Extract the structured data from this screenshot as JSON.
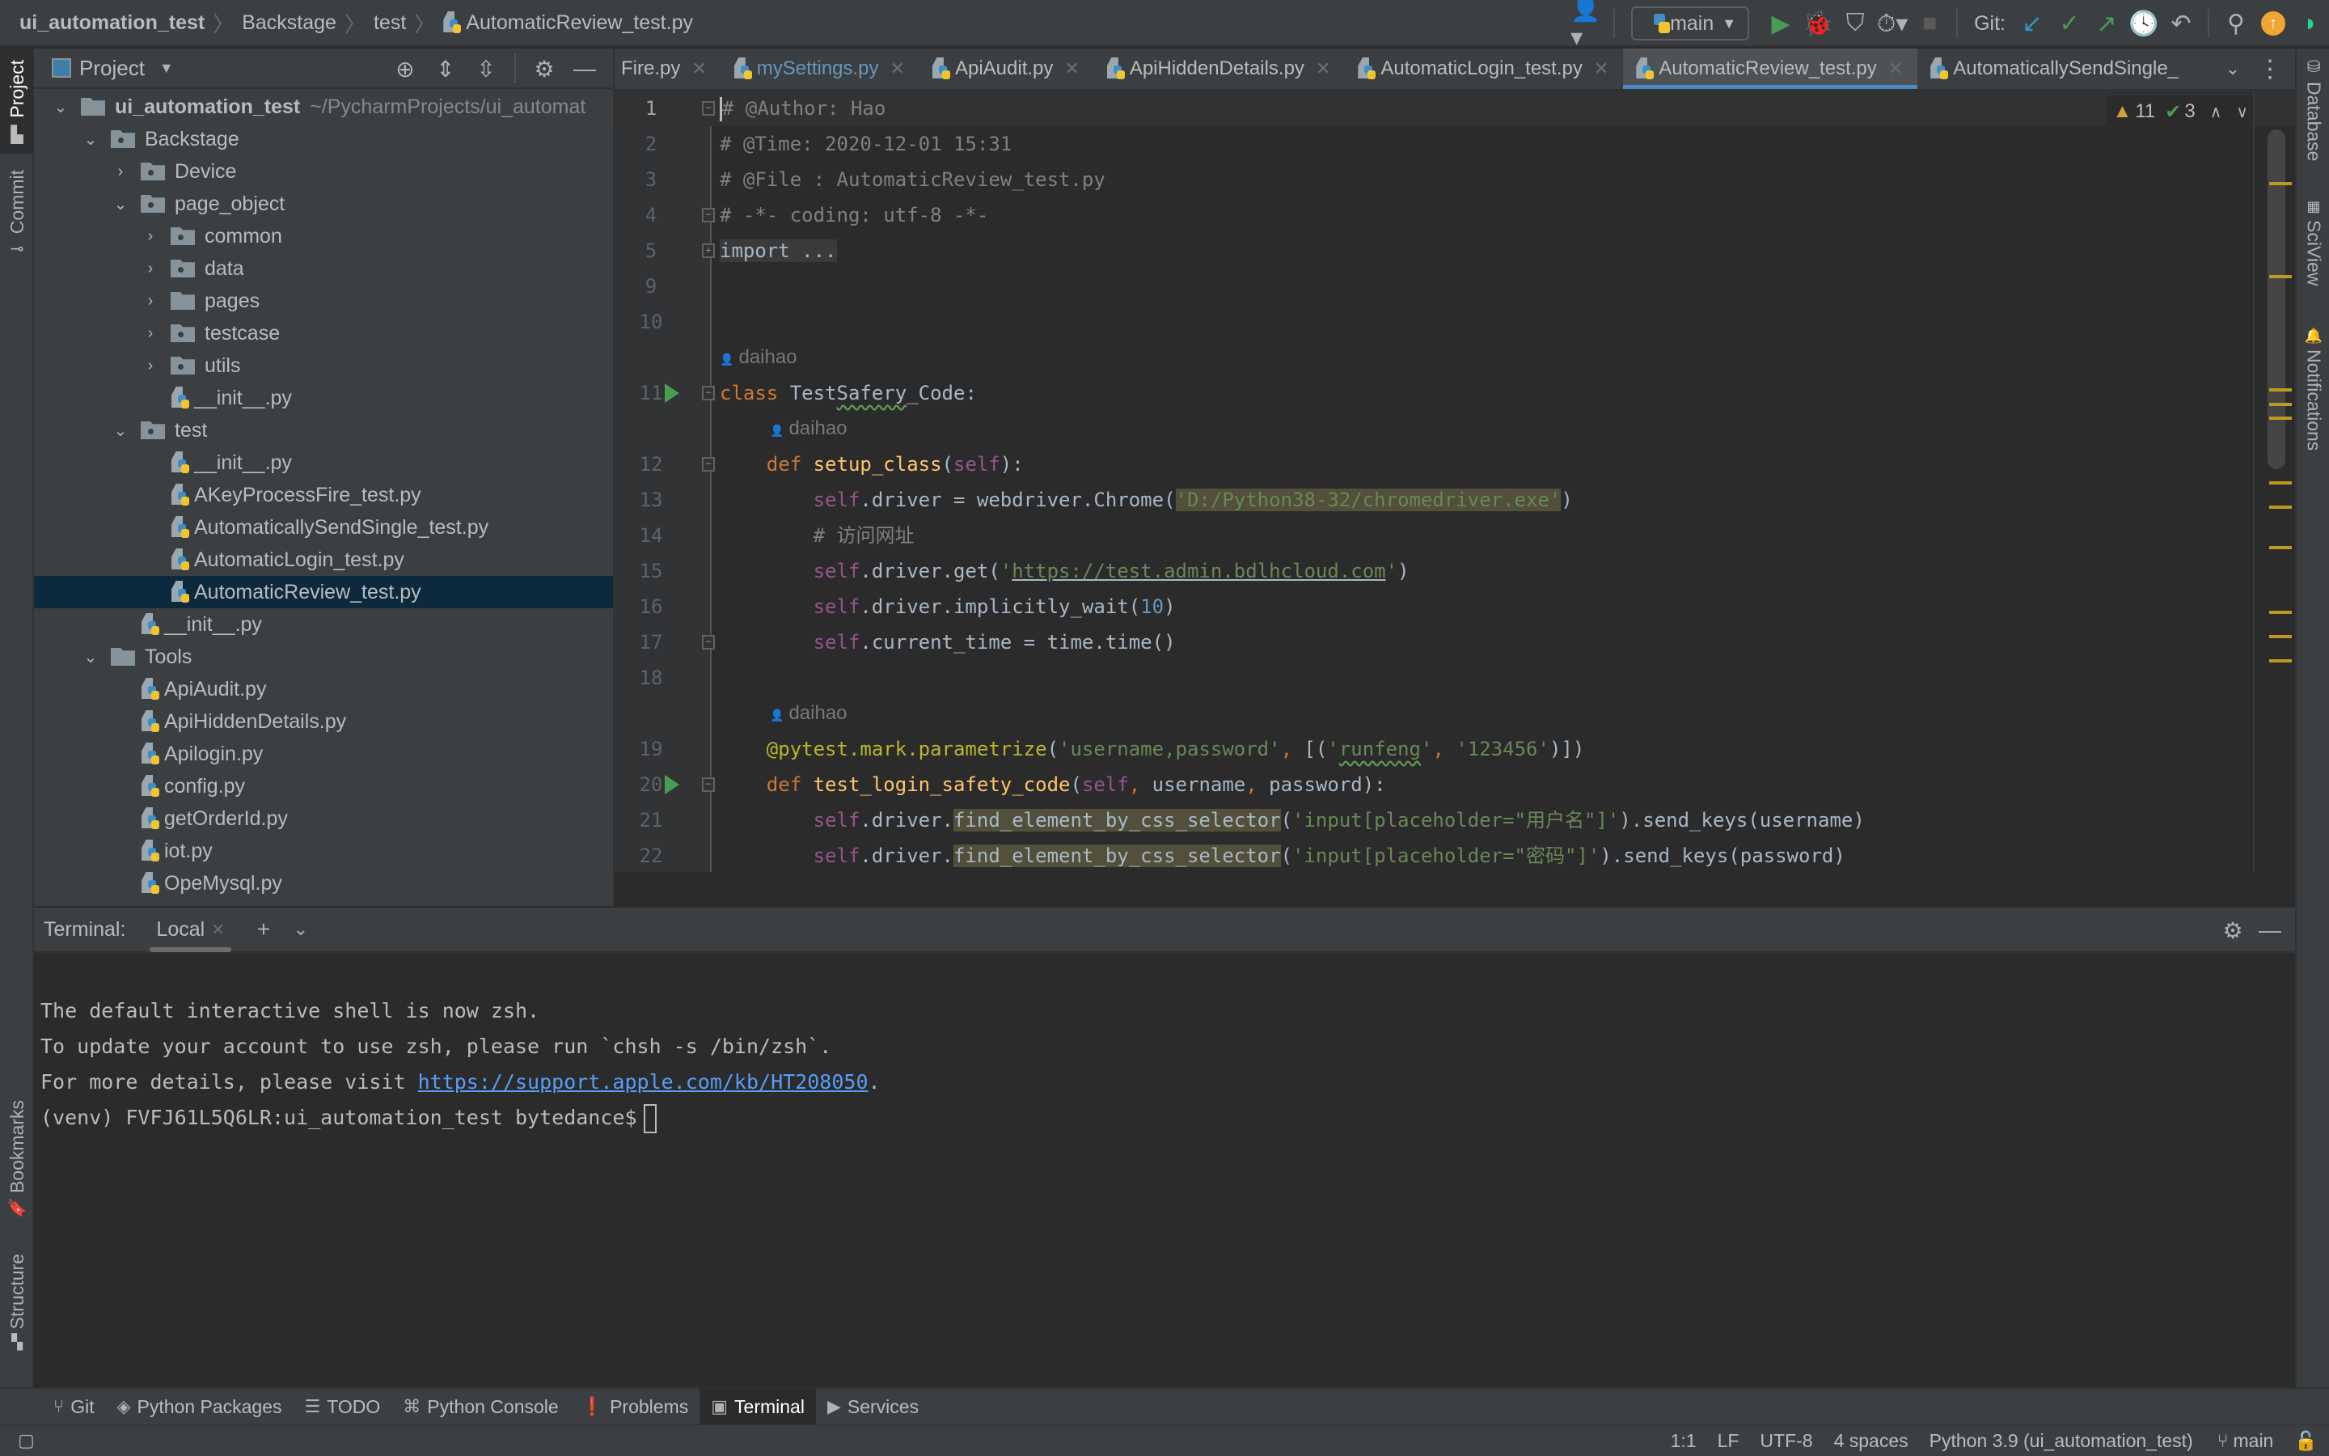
{
  "breadcrumb": [
    "ui_automation_test",
    "Backstage",
    "test",
    "AutomaticReview_test.py"
  ],
  "toolbar": {
    "branch": "main",
    "git_label": "Git:",
    "colors": {
      "run": "#499c54",
      "update_badge": "#f0a732",
      "accent": "#4a88c7"
    }
  },
  "left_stripe": {
    "top": [
      "Project",
      "Commit"
    ],
    "bottom": [
      "Bookmarks",
      "Structure"
    ]
  },
  "right_stripe": [
    "Database",
    "SciView",
    "Notifications"
  ],
  "project": {
    "title": "Project",
    "tree": [
      {
        "label": "ui_automation_test",
        "path": "~/PycharmProjects/ui_automat",
        "type": "folder",
        "depth": 0,
        "expanded": true,
        "bold": true
      },
      {
        "label": "Backstage",
        "type": "pkg",
        "depth": 1,
        "expanded": true
      },
      {
        "label": "Device",
        "type": "pkg",
        "depth": 2,
        "expanded": false
      },
      {
        "label": "page_object",
        "type": "pkg",
        "depth": 2,
        "expanded": true
      },
      {
        "label": "common",
        "type": "pkg",
        "depth": 3,
        "expanded": false
      },
      {
        "label": "data",
        "type": "pkg",
        "depth": 3,
        "expanded": false
      },
      {
        "label": "pages",
        "type": "folder",
        "depth": 3,
        "expanded": false
      },
      {
        "label": "testcase",
        "type": "pkg",
        "depth": 3,
        "expanded": false
      },
      {
        "label": "utils",
        "type": "pkg",
        "depth": 3,
        "expanded": false
      },
      {
        "label": "__init__.py",
        "type": "py",
        "depth": 4
      },
      {
        "label": "test",
        "type": "pkg",
        "depth": 2,
        "expanded": true
      },
      {
        "label": "__init__.py",
        "type": "py",
        "depth": 4
      },
      {
        "label": "AKeyProcessFire_test.py",
        "type": "py",
        "depth": 4
      },
      {
        "label": "AutomaticallySendSingle_test.py",
        "type": "py",
        "depth": 4
      },
      {
        "label": "AutomaticLogin_test.py",
        "type": "py",
        "depth": 4
      },
      {
        "label": "AutomaticReview_test.py",
        "type": "py",
        "depth": 4,
        "selected": true
      },
      {
        "label": "__init__.py",
        "type": "py",
        "depth": 3
      },
      {
        "label": "Tools",
        "type": "folder",
        "depth": 1,
        "expanded": true
      },
      {
        "label": "ApiAudit.py",
        "type": "py",
        "depth": 3
      },
      {
        "label": "ApiHiddenDetails.py",
        "type": "py",
        "depth": 3
      },
      {
        "label": "Apilogin.py",
        "type": "py",
        "depth": 3
      },
      {
        "label": "config.py",
        "type": "py",
        "depth": 3
      },
      {
        "label": "getOrderId.py",
        "type": "py",
        "depth": 3
      },
      {
        "label": "iot.py",
        "type": "py",
        "depth": 3
      },
      {
        "label": "OpeMysql.py",
        "type": "py",
        "depth": 3
      }
    ]
  },
  "tabs": [
    {
      "label": "Fire.py",
      "truncated": true
    },
    {
      "label": "mySettings.py",
      "modified": true
    },
    {
      "label": "ApiAudit.py"
    },
    {
      "label": "ApiHiddenDetails.py"
    },
    {
      "label": "AutomaticLogin_test.py"
    },
    {
      "label": "AutomaticReview_test.py",
      "active": true
    },
    {
      "label": "AutomaticallySendSingle_",
      "no_close": true
    }
  ],
  "inspections": {
    "warnings": "11",
    "weak_warnings": "3"
  },
  "editor": {
    "lines": [
      {
        "n": "1",
        "html": "<span class='cursor'></span><span class='c-comment'># @Author: Hao</span>",
        "fold": "−",
        "current": true
      },
      {
        "n": "2",
        "html": "<span class='c-comment'># @Time: 2020-12-01 15:31</span>"
      },
      {
        "n": "3",
        "html": "<span class='c-comment'># @File : AutomaticReview_test.py</span>"
      },
      {
        "n": "4",
        "html": "<span class='c-comment'># -*- coding: utf-8 -*-</span>",
        "fold": "−"
      },
      {
        "n": "5",
        "html": "<span class='c-fold'>import ...</span>",
        "fold": "+"
      },
      {
        "n": "9",
        "html": ""
      },
      {
        "n": "10",
        "html": ""
      },
      {
        "author": "daihao",
        "indent": 0
      },
      {
        "n": "11",
        "html": "<span class='c-kw'>class </span>Test<span class='c-warn'>Safery</span>_Code:",
        "fold": "−",
        "run": true
      },
      {
        "author": "daihao",
        "indent": 1
      },
      {
        "n": "12",
        "html": "    <span class='c-kw'>def </span><span class='c-fn'>setup_class</span>(<span class='c-self'>self</span>):",
        "fold": "−"
      },
      {
        "n": "13",
        "html": "        <span class='c-self'>self</span>.driver = webdriver.Chrome(<span class='c-str c-hl'>'D:/Python38-32/chromedriver.exe'</span>)"
      },
      {
        "n": "14",
        "html": "        <span class='c-comment'># 访问网址</span>"
      },
      {
        "n": "15",
        "html": "        <span class='c-self'>self</span>.driver.get(<span class='c-str'>'<span class='c-link'>https://test.admin.bdlhcloud.com</span>'</span>)"
      },
      {
        "n": "16",
        "html": "        <span class='c-self'>self</span>.driver.implicitly_wait(<span class='c-num'>10</span>)"
      },
      {
        "n": "17",
        "html": "        <span class='c-self'>self</span>.current_time = time.time()",
        "fold": "−"
      },
      {
        "n": "18",
        "html": ""
      },
      {
        "author": "daihao",
        "indent": 1
      },
      {
        "n": "19",
        "html": "    <span class='c-dec'>@pytest.mark.parametrize</span>(<span class='c-str'>'username,password'</span><span class='c-kw'>, </span>[(<span class='c-str'>'<span class='c-warn'>runfeng</span>'</span><span class='c-kw'>, </span><span class='c-str'>'123456'</span>)])"
      },
      {
        "n": "20",
        "html": "    <span class='c-kw'>def </span><span class='c-fn'>test_login_safety_code</span>(<span class='c-self'>self</span><span class='c-kw'>, </span>username<span class='c-kw'>, </span>password):",
        "fold": "−",
        "run": true
      },
      {
        "n": "21",
        "html": "        <span class='c-self'>self</span>.driver.<span class='c-hl'>find_element_by_css_selector</span>(<span class='c-str'>'input[placeholder=\"用户名\"]'</span>).send_keys(username)"
      },
      {
        "n": "22",
        "html": "        <span class='c-self'>self</span>.driver.<span class='c-hl'>find_element_by_css_selector</span>(<span class='c-str'>'input[placeholder=\"密码\"]'</span>).send_keys(password)"
      }
    ]
  },
  "terminal": {
    "label": "Terminal:",
    "tab": "Local",
    "lines": [
      {
        "text": "The default interactive shell is now zsh."
      },
      {
        "text": "To update your account to use zsh, please run `chsh -s /bin/zsh`."
      },
      {
        "text": "For more details, please visit ",
        "link": "https://support.apple.com/kb/HT208050",
        "after": "."
      },
      {
        "text": "(venv) FVFJ61L5Q6LR:ui_automation_test bytedance$",
        "prompt": true
      }
    ]
  },
  "bottom_tools": [
    {
      "label": "Git",
      "icon": "git-icon",
      "glyph": "⑂"
    },
    {
      "label": "Python Packages",
      "icon": "packages-icon",
      "glyph": "◈"
    },
    {
      "label": "TODO",
      "icon": "todo-icon",
      "glyph": "☰"
    },
    {
      "label": "Python Console",
      "icon": "python-console-icon",
      "glyph": "⌘"
    },
    {
      "label": "Problems",
      "icon": "problems-icon",
      "glyph": "❗"
    },
    {
      "label": "Terminal",
      "icon": "terminal-icon",
      "glyph": "▣",
      "active": true
    },
    {
      "label": "Services",
      "icon": "services-icon",
      "glyph": "▶"
    }
  ],
  "status": {
    "position": "1:1",
    "line_sep": "LF",
    "encoding": "UTF-8",
    "indent": "4 spaces",
    "interpreter": "Python 3.9 (ui_automation_test)",
    "branch": "main"
  }
}
